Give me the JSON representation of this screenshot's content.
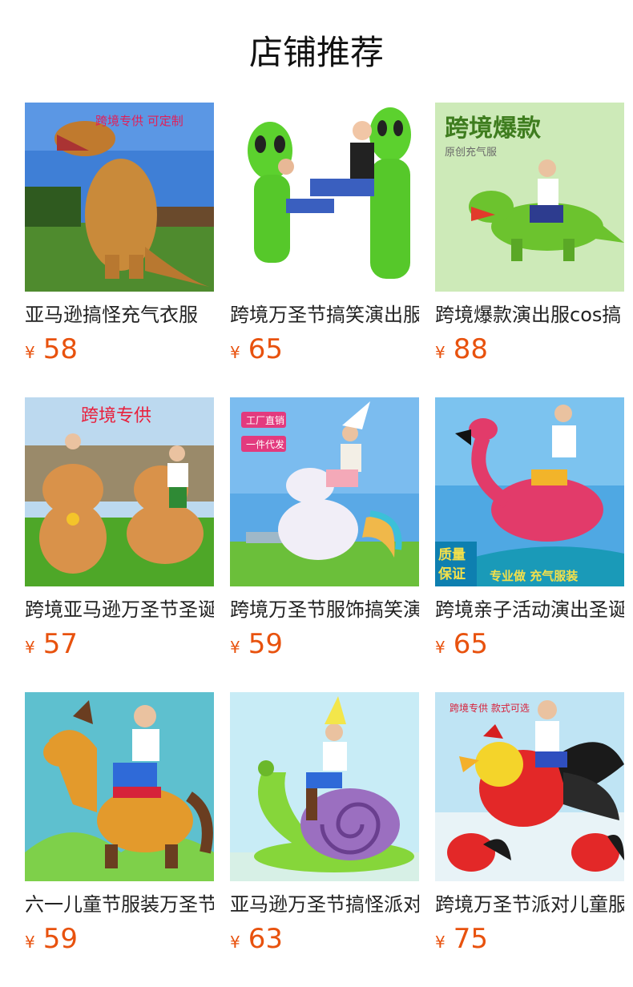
{
  "header": {
    "title": "店铺推荐"
  },
  "products": [
    {
      "name": "亚马逊搞怪充气衣服",
      "currency": "¥",
      "price": "58",
      "badge": "跨境专供 可定制",
      "image": "t-rex-inflatable-photo"
    },
    {
      "name": "跨境万圣节搞笑演出服",
      "currency": "¥",
      "price": "65",
      "badge": "",
      "image": "alien-inflatable-photo"
    },
    {
      "name": "跨境爆款演出服cos搞",
      "currency": "¥",
      "price": "88",
      "badge": "跨境爆款",
      "badge_sub": "原创充气服",
      "image": "dinosaur-rider-photo"
    },
    {
      "name": "跨境亚马逊万圣节圣诞",
      "currency": "¥",
      "price": "57",
      "badge": "跨境专供",
      "image": "reindeer-inflatable-photo"
    },
    {
      "name": "跨境万圣节服饰搞笑演",
      "currency": "¥",
      "price": "59",
      "badge": "工厂直销",
      "badge2": "一件代发",
      "image": "unicorn-rider-photo"
    },
    {
      "name": "跨境亲子活动演出圣诞",
      "currency": "¥",
      "price": "65",
      "badge": "质量保证",
      "badge2": "专业做 充气服装",
      "image": "flamingo-rider-photo"
    },
    {
      "name": "六一儿童节服装万圣节",
      "currency": "¥",
      "price": "59",
      "badge": "",
      "image": "horse-rider-photo"
    },
    {
      "name": "亚马逊万圣节搞怪派对",
      "currency": "¥",
      "price": "63",
      "badge": "",
      "image": "snail-rider-photo"
    },
    {
      "name": "跨境万圣节派对儿童服",
      "currency": "¥",
      "price": "75",
      "badge": "跨境专供 款式可选",
      "image": "rooster-rider-photo"
    }
  ],
  "colors": {
    "price": "#e8520e",
    "title": "#111111",
    "name": "#222222"
  }
}
